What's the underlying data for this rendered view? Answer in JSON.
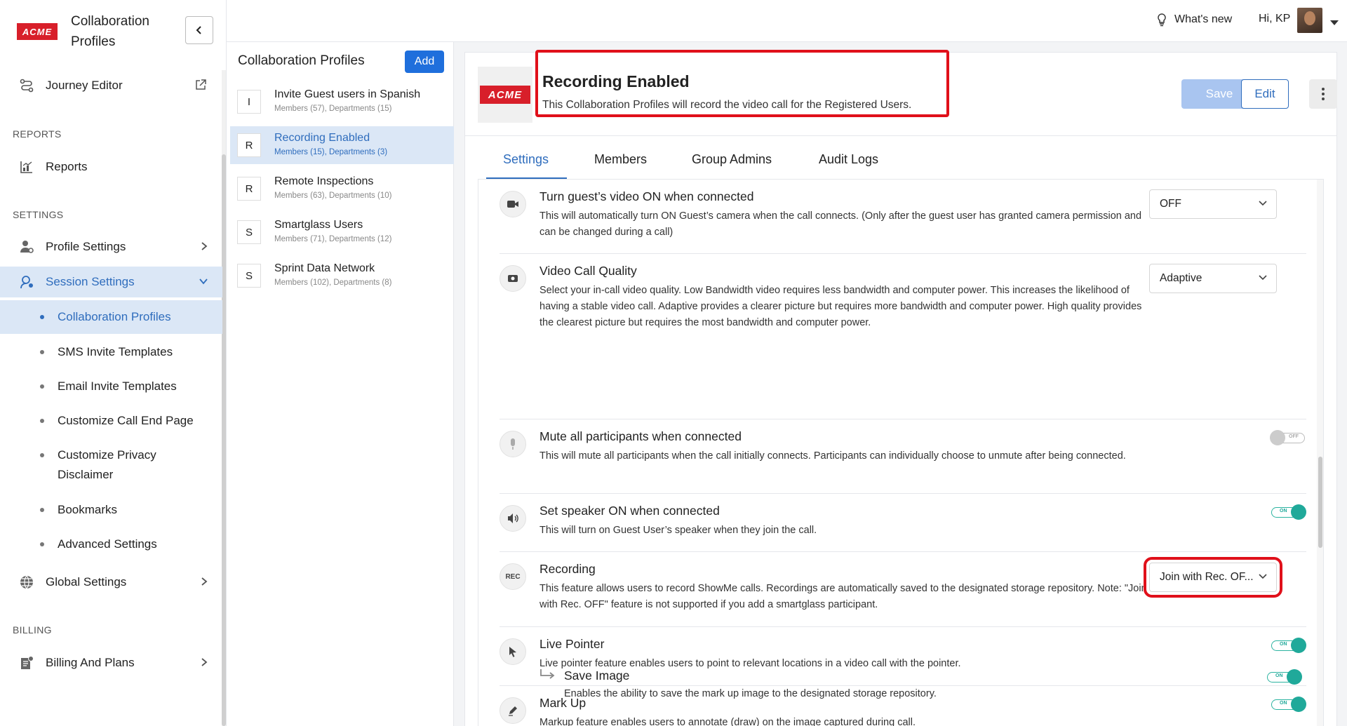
{
  "sidebar": {
    "logo_text": "ACME",
    "app_title": "Collaboration Profiles",
    "journey_editor": "Journey Editor",
    "reports_section": "REPORTS",
    "reports": "Reports",
    "settings_section": "SETTINGS",
    "profile_settings": "Profile Settings",
    "session_settings": "Session Settings",
    "sub_items": [
      "Collaboration Profiles",
      "SMS Invite Templates",
      "Email Invite Templates",
      "Customize Call End Page",
      "Customize Privacy Disclaimer",
      "Bookmarks",
      "Advanced Settings"
    ],
    "global_settings": "Global Settings",
    "billing_section": "BILLING",
    "billing_plans": "Billing And Plans"
  },
  "topbar": {
    "whats_new": "What's new",
    "greeting": "Hi, KP"
  },
  "profiles_list": {
    "title": "Collaboration Profiles",
    "add_label": "Add",
    "items": [
      {
        "initial": "I",
        "name": "Invite Guest users in Spanish",
        "meta": "Members (57), Departments (15)"
      },
      {
        "initial": "R",
        "name": "Recording Enabled",
        "meta": "Members (15), Departments (3)"
      },
      {
        "initial": "R",
        "name": "Remote Inspections",
        "meta": "Members (63), Departments (10)"
      },
      {
        "initial": "S",
        "name": "Smartglass Users",
        "meta": "Members (71), Departments (12)"
      },
      {
        "initial": "S",
        "name": "Sprint Data Network",
        "meta": "Members (102), Departments (8)"
      }
    ]
  },
  "detail": {
    "logo_text": "ACME",
    "title": "Recording Enabled",
    "description": "This Collaboration Profiles will record the video call for the Registered Users.",
    "save_label": "Save",
    "edit_label": "Edit",
    "tabs": [
      "Settings",
      "Members",
      "Group Admins",
      "Audit Logs"
    ],
    "settings": [
      {
        "title": "Turn guest’s video ON when connected",
        "desc": "This will automatically turn ON Guest’s camera when the call connects. (Only after the guest user has granted camera permission and can be changed during a call)",
        "value": "OFF"
      },
      {
        "title": "Video Call Quality",
        "desc": "Select your in-call video quality. Low Bandwidth video requires less bandwidth and computer power. This increases the likelihood of having a stable video call. Adaptive provides a clearer picture but requires more bandwidth and computer power. High quality provides the clearest picture but requires the most bandwidth and computer power.",
        "value": "Adaptive"
      },
      {
        "title": "Mute all participants when connected",
        "desc": "This will mute all participants when the call initially connects. Participants can individually choose to unmute after being connected.",
        "toggle": "OFF"
      },
      {
        "title": "Set speaker ON when connected",
        "desc": "This will turn on Guest User’s speaker when they join the call.",
        "toggle": "ON"
      },
      {
        "title": "Recording",
        "icon_text": "REC",
        "desc": "This feature allows users to record ShowMe calls. Recordings are automatically saved to the designated storage repository. Note: \"Join with Rec. OFF\" feature is not supported if you add a smartglass participant.",
        "value": "Join with Rec. OF..."
      },
      {
        "title": "Live Pointer",
        "desc": "Live pointer feature enables users to point to relevant locations in a video call with the pointer.",
        "toggle": "ON"
      },
      {
        "title": "Mark Up",
        "desc": "Markup feature enables users to annotate (draw) on the image captured during call.",
        "toggle": "ON"
      },
      {
        "title": "Save Image",
        "desc": "Enables the ability to save the mark up image to the designated storage repository.",
        "toggle": "ON"
      }
    ]
  },
  "colors": {
    "brand_red": "#d81f2a",
    "accent_blue": "#2f6dbd",
    "toggle_on": "#20a99a",
    "highlight_red": "#e0101a"
  }
}
